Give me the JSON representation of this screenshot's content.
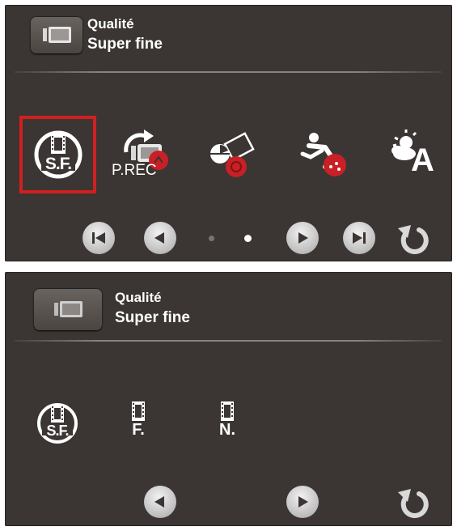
{
  "top_screen": {
    "header": {
      "label": "Qualité",
      "value": "Super fine",
      "icon": "film-quality-icon"
    },
    "options": [
      {
        "icon": "quality-super-fine-icon",
        "text": "S.F.",
        "selected": true
      },
      {
        "icon": "pre-rec-icon",
        "text": "P.REC",
        "selected": false
      },
      {
        "icon": "self-timer-icon",
        "text": "",
        "selected": false
      },
      {
        "icon": "sport-mode-icon",
        "text": "",
        "selected": false
      },
      {
        "icon": "auto-scene-icon",
        "text": "A",
        "selected": false
      }
    ],
    "pagination": {
      "pages": 2,
      "current": 2
    },
    "nav": [
      "first-page-icon",
      "previous-icon",
      "next-icon",
      "last-page-icon",
      "back-return-icon"
    ],
    "selection_color": "#d21f1f"
  },
  "bottom_screen": {
    "header": {
      "label": "Qualité",
      "value": "Super fine",
      "icon": "film-quality-icon"
    },
    "options": [
      {
        "icon": "quality-super-fine-icon",
        "text": "S.F."
      },
      {
        "icon": "quality-fine-icon",
        "text": "F."
      },
      {
        "icon": "quality-normal-icon",
        "text": "N."
      }
    ],
    "nav": [
      "previous-icon",
      "next-icon",
      "back-return-icon"
    ]
  },
  "colors": {
    "panel_bg": "#3b3633",
    "text": "#ffffff",
    "accent_red": "#d21f1f"
  }
}
